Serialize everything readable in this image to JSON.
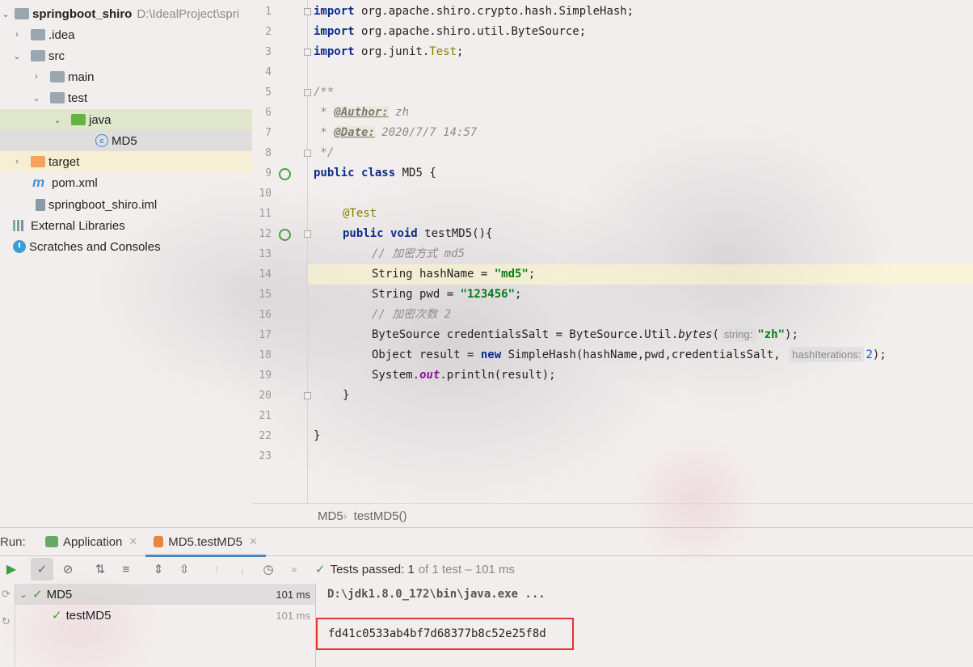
{
  "project": {
    "root_name": "springboot_shiro",
    "root_path": "D:\\IdealProject\\spri",
    "items": [
      {
        "label": ".idea"
      },
      {
        "label": "src"
      },
      {
        "label": "main"
      },
      {
        "label": "test"
      },
      {
        "label": "java"
      },
      {
        "label": "MD5"
      },
      {
        "label": "target"
      },
      {
        "label": "pom.xml"
      },
      {
        "label": "springboot_shiro.iml"
      },
      {
        "label": "External Libraries"
      },
      {
        "label": "Scratches and Consoles"
      }
    ]
  },
  "editor": {
    "line_numbers": [
      "1",
      "2",
      "3",
      "4",
      "5",
      "6",
      "7",
      "8",
      "9",
      "10",
      "11",
      "12",
      "13",
      "14",
      "15",
      "16",
      "17",
      "18",
      "19",
      "20",
      "21",
      "22",
      "23"
    ],
    "code": {
      "l1_kw": "import",
      "l1_rest": " org.apache.shiro.crypto.hash.SimpleHash;",
      "l2_kw": "import",
      "l2_rest": " org.apache.shiro.util.ByteSource;",
      "l3_kw": "import",
      "l3_pre": " org.junit.",
      "l3_cls": "Test",
      "l3_end": ";",
      "l5": "/**",
      "l6_pre": " * ",
      "l6_tag": "@Author:",
      "l6_val": " zh",
      "l7_pre": " * ",
      "l7_tag": "@Date:",
      "l7_val": " 2020/7/7 14:57",
      "l8": " */",
      "l9_kw1": "public",
      "l9_kw2": "class",
      "l9_rest": " MD5 {",
      "l11": "@Test",
      "l12_kw1": "public",
      "l12_kw2": "void",
      "l12_rest": " testMD5(){",
      "l13": "// 加密方式 md5",
      "l14_pre": "String hashName = ",
      "l14_str": "\"md5\"",
      "l14_end": ";",
      "l15_pre": "String pwd = ",
      "l15_str": "\"123456\"",
      "l15_end": ";",
      "l16": "// 加密次数 2",
      "l17_pre": "ByteSource credentialsSalt = ByteSource.Util.",
      "l17_m": "bytes",
      "l17_paren": "(",
      "l17_hint": "string:",
      "l17_str": "\"zh\"",
      "l17_end": ");",
      "l18_pre": "Object result = ",
      "l18_kw": "new",
      "l18_mid": " SimpleHash(hashName,pwd,credentialsSalt, ",
      "l18_hint": "hashIterations:",
      "l18_num": "2",
      "l18_end": ");",
      "l19_pre": "System.",
      "l19_fld": "out",
      "l19_end": ".println(result);",
      "l20": "}",
      "l22": "}"
    }
  },
  "breadcrumbs": [
    "MD5",
    "testMD5()"
  ],
  "run": {
    "label": "Run:",
    "tabs": [
      {
        "label": "Application"
      },
      {
        "label": "MD5.testMD5"
      }
    ],
    "status": {
      "prefix": "Tests passed:",
      "count": "1",
      "suffix": "of 1 test – 101 ms"
    },
    "tree": [
      {
        "label": "MD5",
        "time": "101 ms"
      },
      {
        "label": "testMD5",
        "time": "101 ms"
      }
    ],
    "console": {
      "command": "D:\\jdk1.8.0_172\\bin\\java.exe ...",
      "output": "fd41c0533ab4bf7d68377b8c52e25f8d"
    }
  },
  "colors": {
    "keyword": "#0a2d8c",
    "string": "#067d17",
    "annotation": "#808000",
    "success": "#3f9c3f",
    "highlight_box": "#e53333"
  }
}
